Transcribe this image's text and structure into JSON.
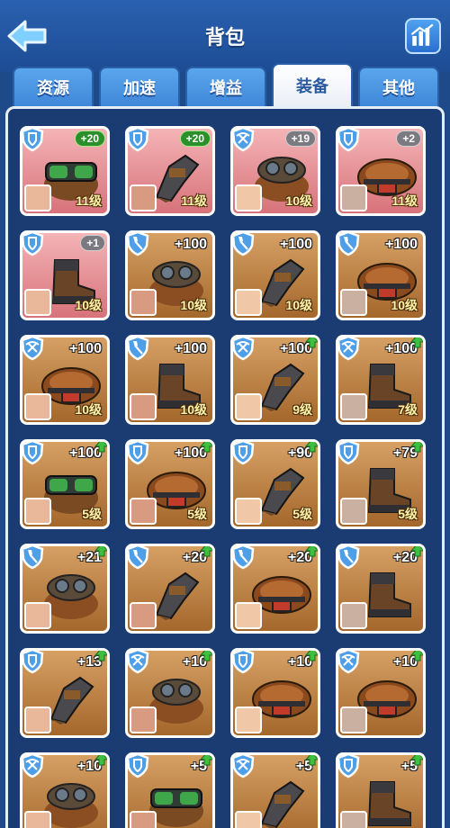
{
  "header": {
    "title": "背包"
  },
  "tabs": [
    {
      "label": "资源",
      "active": false
    },
    {
      "label": "加速",
      "active": false
    },
    {
      "label": "增益",
      "active": false
    },
    {
      "label": "装备",
      "active": true
    },
    {
      "label": "其他",
      "active": false
    }
  ],
  "colors": {
    "background": "#1e4a8a",
    "card_normal": "#c8894c",
    "card_red": "#e8959a",
    "level_text": "#fff4a8",
    "upgrade_green": "#3fbf3f"
  },
  "items": [
    {
      "type": "shield",
      "equip": "goggles",
      "badge": "+20",
      "badge_style": "green",
      "level": "11级",
      "red": true
    },
    {
      "type": "shield",
      "equip": "gauntlet",
      "badge": "+20",
      "badge_style": "green",
      "level": "11级",
      "red": true
    },
    {
      "type": "crossbow",
      "equip": "goggles-bronze",
      "badge": "+19",
      "badge_style": "gray",
      "level": "10级",
      "red": true
    },
    {
      "type": "shield",
      "equip": "belt",
      "badge": "+2",
      "badge_style": "gray",
      "level": "11级",
      "red": true
    },
    {
      "type": "shield",
      "equip": "boot",
      "badge": "+1",
      "badge_style": "gray",
      "level": "10级",
      "red": true
    },
    {
      "type": "shovel",
      "equip": "goggles-bronze",
      "badge": "+100",
      "badge_style": "text",
      "level": "10级",
      "red": false
    },
    {
      "type": "shovel",
      "equip": "gauntlet",
      "badge": "+100",
      "badge_style": "text",
      "level": "10级",
      "red": false
    },
    {
      "type": "shovel",
      "equip": "belt",
      "badge": "+100",
      "badge_style": "text",
      "level": "10级",
      "red": false
    },
    {
      "type": "crossbow",
      "equip": "belt",
      "badge": "+100",
      "badge_style": "text",
      "level": "10级",
      "red": false
    },
    {
      "type": "shovel",
      "equip": "boot",
      "badge": "+100",
      "badge_style": "text",
      "level": "10级",
      "red": false
    },
    {
      "type": "crossbow",
      "equip": "gauntlet",
      "badge": "+100",
      "badge_style": "text",
      "level": "9级",
      "red": false,
      "up": true
    },
    {
      "type": "crossbow",
      "equip": "boot",
      "badge": "+100",
      "badge_style": "text",
      "level": "7级",
      "red": false,
      "up": true
    },
    {
      "type": "shield",
      "equip": "goggles",
      "badge": "+100",
      "badge_style": "text",
      "level": "5级",
      "red": false,
      "up": true
    },
    {
      "type": "shield",
      "equip": "belt",
      "badge": "+100",
      "badge_style": "text",
      "level": "5级",
      "red": false,
      "up": true
    },
    {
      "type": "shield",
      "equip": "gauntlet",
      "badge": "+90",
      "badge_style": "text",
      "level": "5级",
      "red": false,
      "up": true
    },
    {
      "type": "shield",
      "equip": "boot",
      "badge": "+79",
      "badge_style": "text",
      "level": "5级",
      "red": false,
      "up": true
    },
    {
      "type": "shovel",
      "equip": "goggles-bronze",
      "badge": "+21",
      "badge_style": "text",
      "level": "",
      "red": false,
      "up": true
    },
    {
      "type": "shovel",
      "equip": "gauntlet",
      "badge": "+20",
      "badge_style": "text",
      "level": "",
      "red": false,
      "up": true
    },
    {
      "type": "shovel",
      "equip": "belt",
      "badge": "+20",
      "badge_style": "text",
      "level": "",
      "red": false,
      "up": true
    },
    {
      "type": "shovel",
      "equip": "boot",
      "badge": "+20",
      "badge_style": "text",
      "level": "",
      "red": false,
      "up": true
    },
    {
      "type": "shield",
      "equip": "gauntlet",
      "badge": "+13",
      "badge_style": "text",
      "level": "",
      "red": false,
      "up": true
    },
    {
      "type": "crossbow",
      "equip": "goggles-bronze",
      "badge": "+10",
      "badge_style": "text",
      "level": "",
      "red": false,
      "up": true
    },
    {
      "type": "shield",
      "equip": "belt",
      "badge": "+10",
      "badge_style": "text",
      "level": "",
      "red": false,
      "up": true
    },
    {
      "type": "crossbow",
      "equip": "belt",
      "badge": "+10",
      "badge_style": "text",
      "level": "",
      "red": false,
      "up": true
    },
    {
      "type": "crossbow",
      "equip": "goggles-bronze",
      "badge": "+10",
      "badge_style": "text",
      "level": "",
      "red": false,
      "up": true
    },
    {
      "type": "shield",
      "equip": "goggles",
      "badge": "+5",
      "badge_style": "text",
      "level": "",
      "red": false,
      "up": true
    },
    {
      "type": "crossbow",
      "equip": "gauntlet",
      "badge": "+5",
      "badge_style": "text",
      "level": "",
      "red": false,
      "up": true
    },
    {
      "type": "shield",
      "equip": "boot",
      "badge": "+5",
      "badge_style": "text",
      "level": "",
      "red": false,
      "up": true
    }
  ]
}
